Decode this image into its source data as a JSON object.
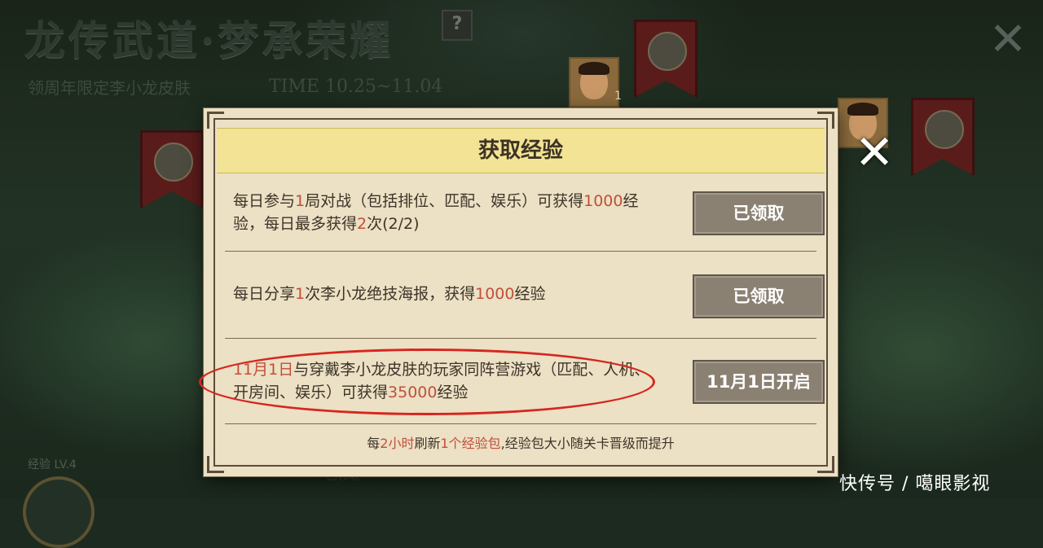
{
  "background": {
    "event_title": "龙传武道·梦承荣耀",
    "event_subtitle": "领周年限定李小龙皮肤",
    "event_time": "TIME 10.25~11.04",
    "help_label": "?",
    "portrait_count": "1",
    "level_label": "经验 LV.4",
    "faint_status": "已领取"
  },
  "modal": {
    "title": "获取经验",
    "tasks": [
      {
        "parts": [
          {
            "t": "每日参与",
            "h": false
          },
          {
            "t": "1",
            "h": true
          },
          {
            "t": "局对战（包括排位、匹配、娱乐）可获得",
            "h": false
          },
          {
            "t": "1000",
            "h": true
          },
          {
            "t": "经验，每日最多获得",
            "h": false
          },
          {
            "t": "2",
            "h": true
          },
          {
            "t": "次(2/2)",
            "h": false
          }
        ],
        "button": "已领取"
      },
      {
        "parts": [
          {
            "t": "每日分享",
            "h": false
          },
          {
            "t": "1",
            "h": true
          },
          {
            "t": "次李小龙绝技海报，获得",
            "h": false
          },
          {
            "t": "1000",
            "h": true
          },
          {
            "t": "经验",
            "h": false
          }
        ],
        "button": "已领取"
      },
      {
        "parts": [
          {
            "t": "11月1日",
            "h": true
          },
          {
            "t": "与穿戴李小龙皮肤的玩家同阵营游戏（匹配、人机、开房间、娱乐）可获得",
            "h": false
          },
          {
            "t": "35000",
            "h": true
          },
          {
            "t": "经验",
            "h": false
          }
        ],
        "button": "11月1日开启"
      }
    ],
    "footer_parts": [
      {
        "t": "每",
        "h": false
      },
      {
        "t": "2小时",
        "h": true
      },
      {
        "t": "刷新",
        "h": false
      },
      {
        "t": "1个经验包",
        "h": true
      },
      {
        "t": ",经验包大小随关卡晋级而提升",
        "h": false
      }
    ],
    "close_icon": "close-icon"
  },
  "watermark": "快传号 / 噶眼影视",
  "colors": {
    "highlight": "#c0503a",
    "header_bg": "#f3e394",
    "panel_bg": "#ece0c5",
    "button_bg": "#8b8173",
    "annotation": "#d6261e"
  }
}
